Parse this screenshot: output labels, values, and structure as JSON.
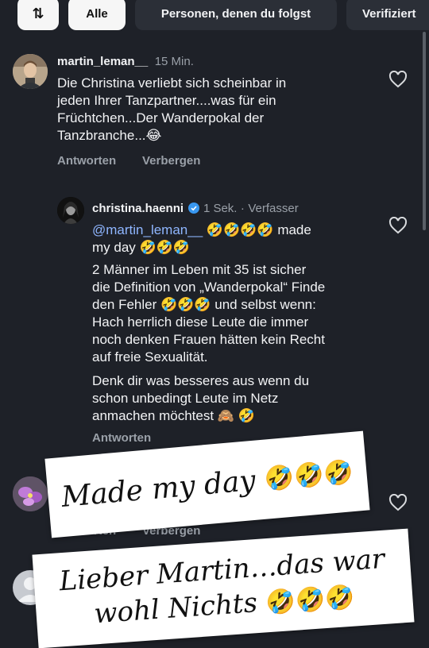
{
  "filters": {
    "sort_icon_label": "⇅",
    "items": [
      {
        "label": "Alle",
        "selected": true
      },
      {
        "label": "Personen, denen du folgst",
        "selected": false
      },
      {
        "label": "Verifiziert",
        "selected": false
      }
    ]
  },
  "comments": [
    {
      "username": "martin_leman__",
      "time": "15 Min.",
      "text_lines": [
        "Die Christina verliebt sich scheinbar in",
        "jeden Ihrer Tanzpartner....was für ein",
        "Früchtchen...Der Wanderpokal der",
        "Tanzbranche..."
      ],
      "emoji": "😂",
      "reply_label": "Antworten",
      "hide_label": "Verbergen"
    },
    {
      "username": "christina.haenni",
      "verified": true,
      "time": "1 Sek.",
      "author_label": "Verfasser",
      "mention": "@martin_leman__",
      "line1_suffix": "made",
      "line2_prefix": "my day",
      "para2_lines": [
        "2 Männer im Leben mit 35 ist sicher",
        "die Definition von „Wanderpokal“ Finde",
        "den Fehler",
        "und selbst wenn:",
        "Hach herrlich diese Leute die immer",
        "noch denken Frauen hätten kein Recht",
        "auf freie Sexualität."
      ],
      "para3_lines": [
        "Denk dir was besseres aus wenn du",
        "schon unbedingt Leute im Netz",
        "anmachen möchtest"
      ],
      "para3_emojis": [
        "🙈",
        "🤣"
      ],
      "rofl_emoji": "🤣",
      "reply_label": "Antworten"
    },
    {
      "reply_label": "Antworten",
      "hide_label": "Verbergen"
    }
  ],
  "overlays": {
    "first": {
      "text": "Made my day",
      "emoji": "🤣🤣🤣"
    },
    "second": {
      "line1": "Lieber Martin…das war",
      "line2": "wohl Nichts",
      "emoji": "🤣🤣🤣"
    }
  },
  "colors": {
    "background": "#1e2128",
    "chip_selected": "#f6f6f6",
    "chip_unselected": "#2b2f37",
    "muted": "#9aa0a8",
    "mention": "#8fb6ff",
    "verified": "#3897f0"
  },
  "icons": {
    "like": "heart-outline-icon",
    "verified": "verified-badge-icon",
    "sort": "sort-arrows-icon",
    "default_avatar": "person-silhouette-icon"
  }
}
